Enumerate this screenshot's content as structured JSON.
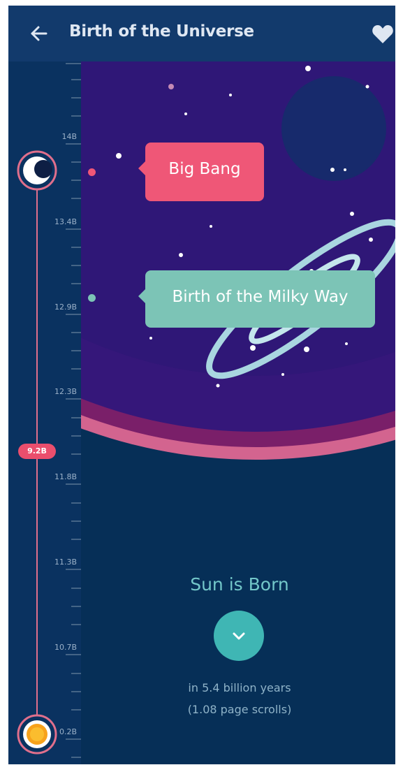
{
  "header": {
    "title": "Birth of the Universe",
    "back_icon": "arrow-left-icon",
    "favorite_icon": "heart-icon"
  },
  "timeline": {
    "tick_labels": [
      "14B",
      "13.4B",
      "12.9B",
      "12.3B",
      "11.8B",
      "11.3B",
      "10.7B",
      "0.2B"
    ],
    "current_marker": "9.2B",
    "top_icon": "moon-icon",
    "bottom_icon": "sun-icon"
  },
  "events": [
    {
      "label": "Big Bang",
      "color": "#ef5777"
    },
    {
      "label": "Birth of the Milky Way",
      "color": "#7cc4b6"
    }
  ],
  "next_event": {
    "title": "Sun is Born",
    "button_icon": "chevron-down-icon",
    "eta": "in 5.4 billion years",
    "scrolls": "(1.08 page scrolls)"
  },
  "colors": {
    "background": "#062f57",
    "header": "#123a6c",
    "accent_pink": "#ef5777",
    "accent_teal": "#3fb6b4",
    "planet_purple": "#3a1a78"
  }
}
